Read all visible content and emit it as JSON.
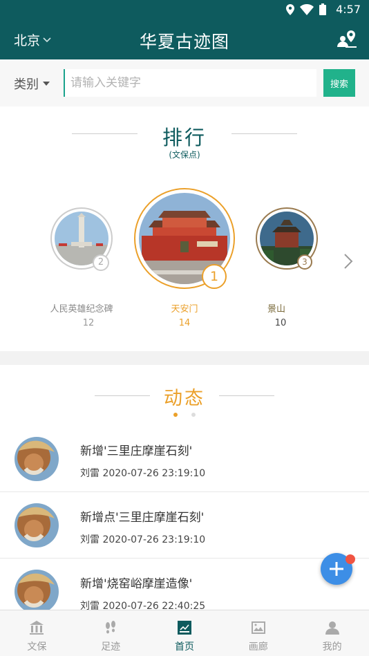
{
  "status_bar": {
    "time": "4:57",
    "icons": [
      "location-icon",
      "wifi-icon",
      "battery-icon"
    ]
  },
  "app_bar": {
    "city": "北京",
    "title": "华夏古迹图"
  },
  "search": {
    "category_label": "类别",
    "placeholder": "请输入关键字",
    "button_label": "搜索"
  },
  "ranking": {
    "title": "排行",
    "subtitle": "(文保点)",
    "items": [
      {
        "rank": "2",
        "name": "人民英雄纪念碑",
        "count": "12"
      },
      {
        "rank": "1",
        "name": "天安门",
        "count": "14"
      },
      {
        "rank": "3",
        "name": "景山",
        "count": "10"
      }
    ]
  },
  "feed": {
    "title": "动态",
    "items": [
      {
        "text": "新增'三里庄摩崖石刻'",
        "meta": "刘雷 2020-07-26 23:19:10"
      },
      {
        "text": "新增点'三里庄摩崖石刻'",
        "meta": "刘雷 2020-07-26 23:19:10"
      },
      {
        "text": "新增'烧窑峪摩崖造像'",
        "meta": "刘雷 2020-07-26 22:40:25"
      }
    ]
  },
  "bottom_nav": [
    {
      "label": "文保",
      "icon": "museum-icon"
    },
    {
      "label": "足迹",
      "icon": "footprints-icon"
    },
    {
      "label": "首页",
      "icon": "home-board-icon",
      "active": true
    },
    {
      "label": "画廊",
      "icon": "gallery-icon"
    },
    {
      "label": "我的",
      "icon": "profile-icon"
    }
  ],
  "colors": {
    "primary": "#0e5b5e",
    "accent_gold": "#eba02a",
    "search_button": "#21b28b",
    "fab": "#3d8ee6",
    "fab_dot": "#f05442"
  }
}
